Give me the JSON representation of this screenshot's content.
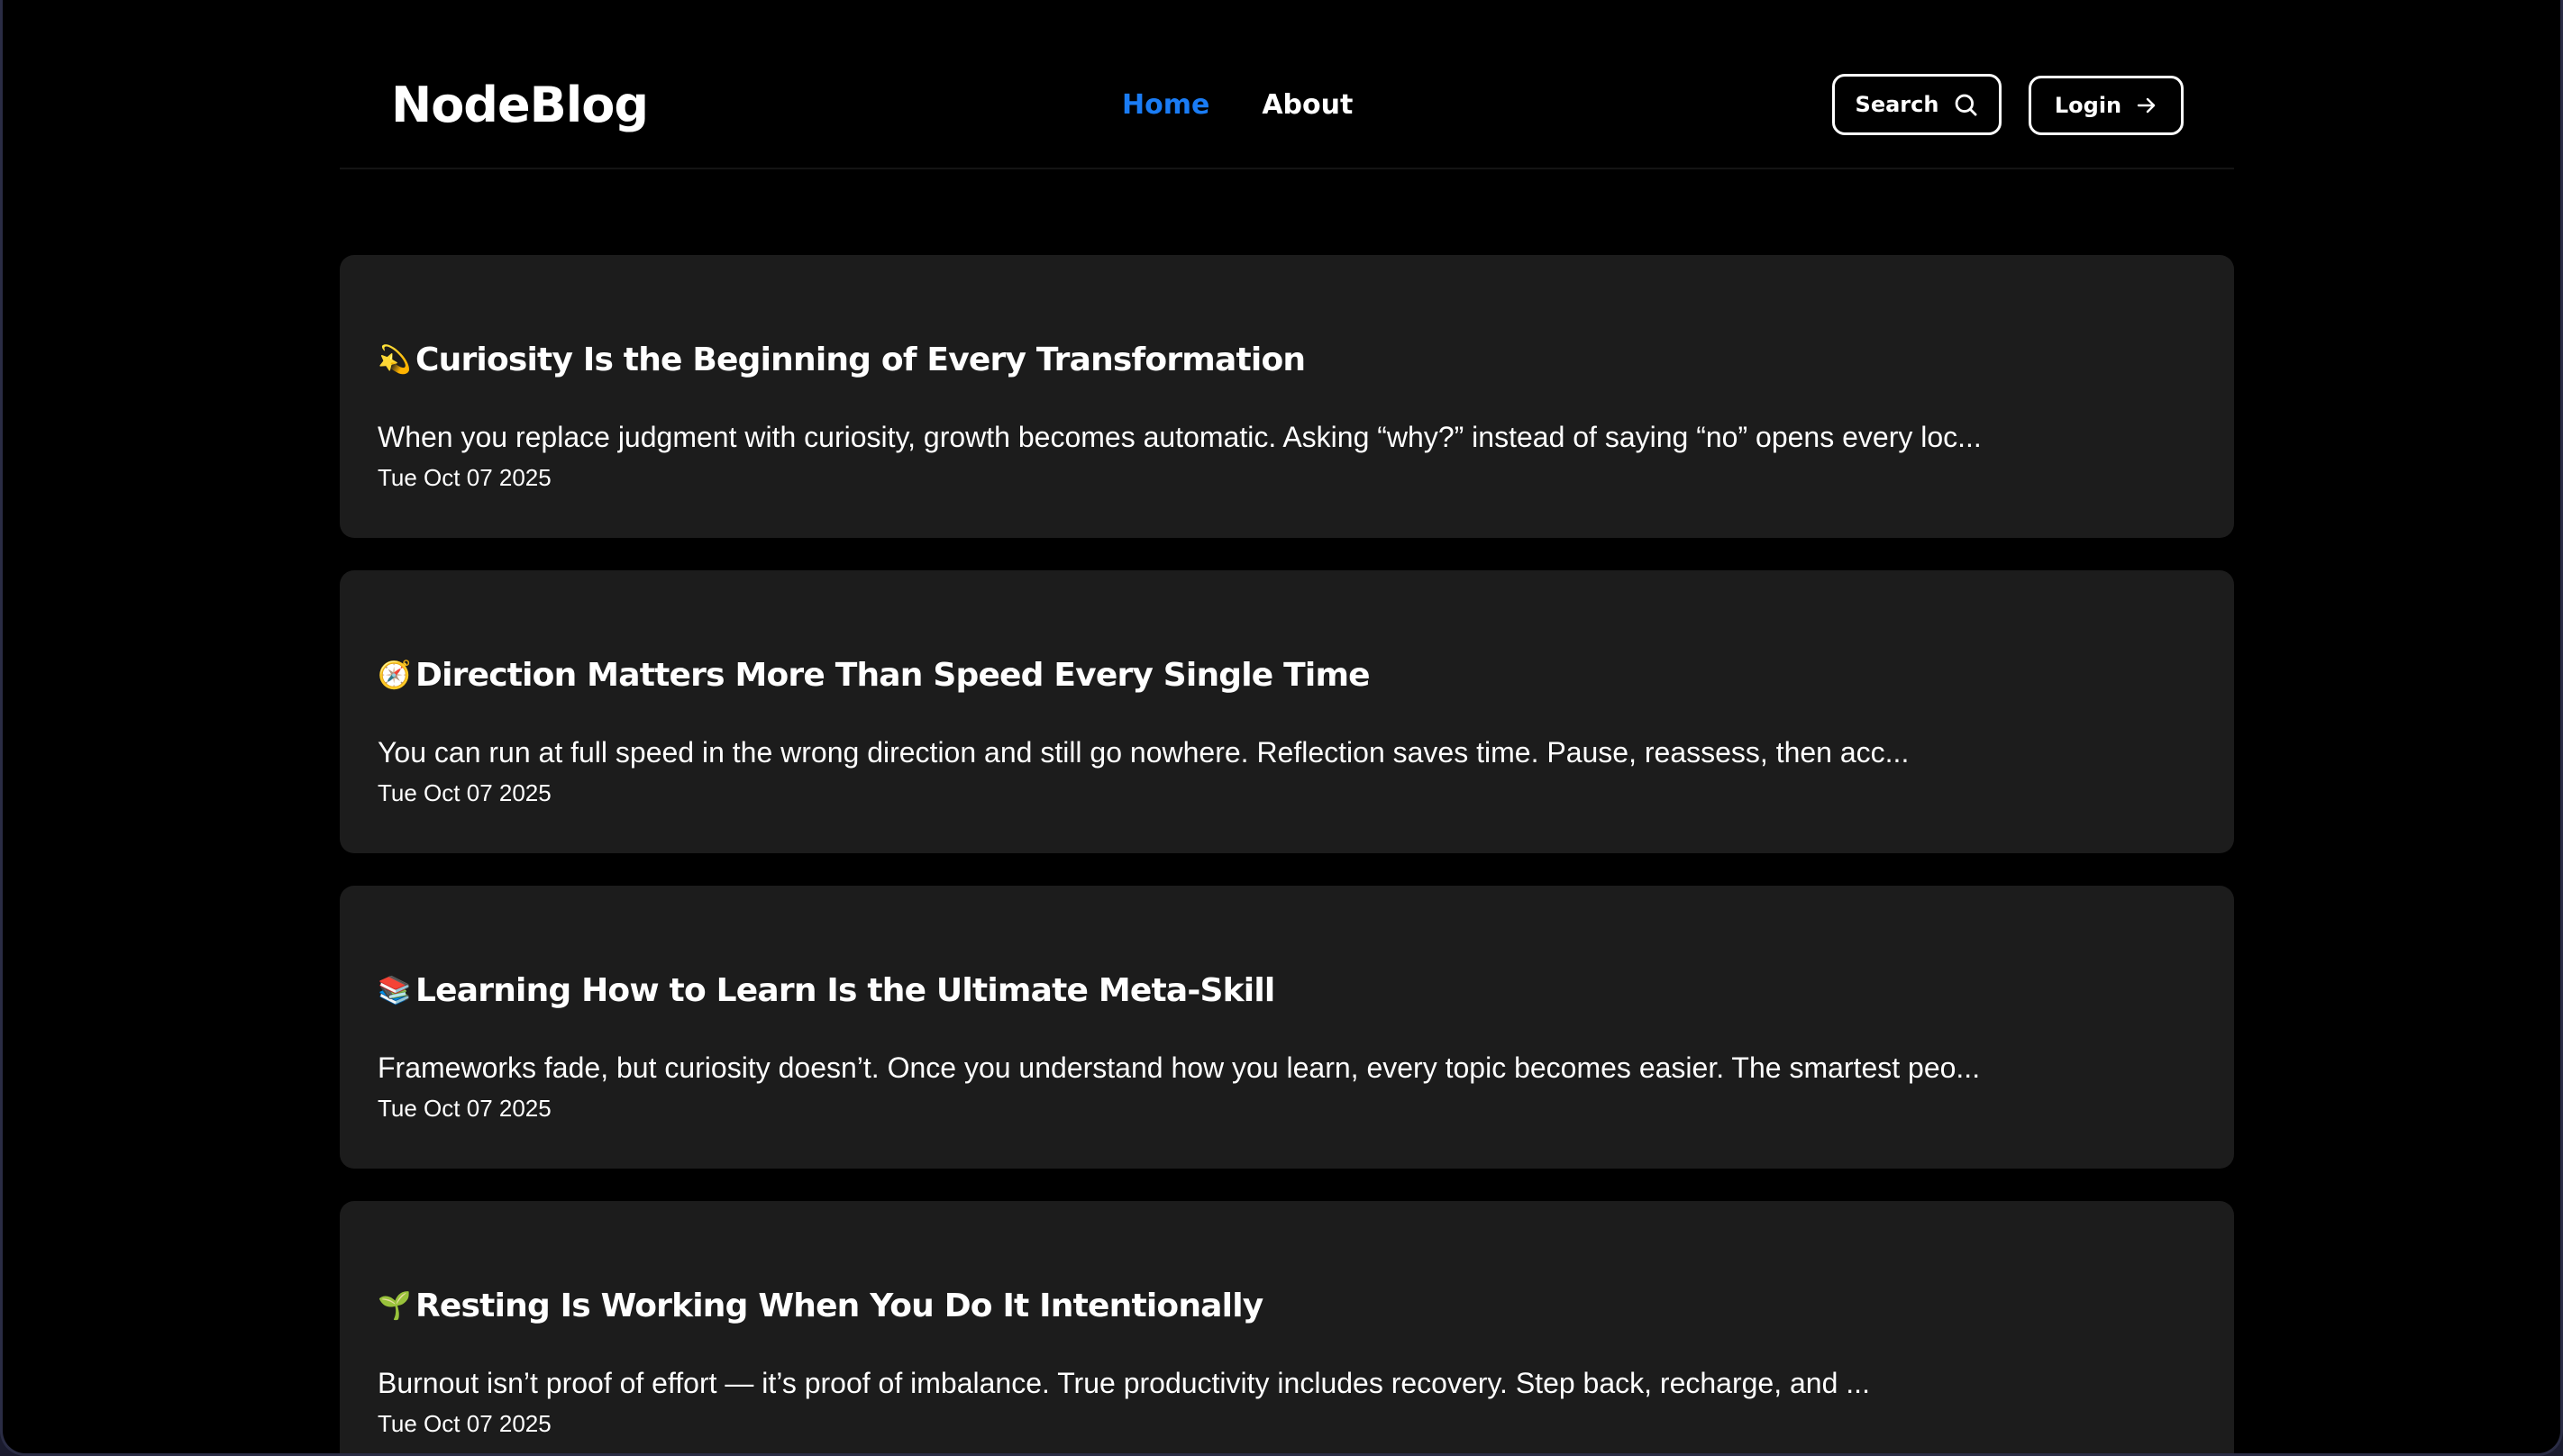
{
  "site": {
    "logo": "NodeBlog"
  },
  "nav": {
    "items": [
      {
        "label": "Home",
        "active": true
      },
      {
        "label": "About",
        "active": false
      }
    ]
  },
  "actions": {
    "search_label": "Search",
    "search_icon": "search-icon",
    "login_label": "Login",
    "login_icon": "arrow-right-icon"
  },
  "colors": {
    "background": "#000000",
    "card": "#1c1c1c",
    "accent": "#1a7cf5",
    "text": "#ffffff"
  },
  "posts": [
    {
      "emoji": "💫",
      "emoji_icon": "dizzy-star-icon",
      "title": "Curiosity Is the Beginning of Every Transformation",
      "excerpt": "When you replace judgment with curiosity, growth becomes automatic. Asking “why?” instead of saying “no” opens every loc...",
      "date": "Tue Oct 07 2025"
    },
    {
      "emoji": "🧭",
      "emoji_icon": "compass-icon",
      "title": "Direction Matters More Than Speed Every Single Time",
      "excerpt": "You can run at full speed in the wrong direction and still go nowhere. Reflection saves time. Pause, reassess, then acc...",
      "date": "Tue Oct 07 2025"
    },
    {
      "emoji": "📚",
      "emoji_icon": "books-icon",
      "title": "Learning How to Learn Is the Ultimate Meta-Skill",
      "excerpt": "Frameworks fade, but curiosity doesn’t. Once you understand how you learn, every topic becomes easier. The smartest peo...",
      "date": "Tue Oct 07 2025"
    },
    {
      "emoji": "🌱",
      "emoji_icon": "seedling-icon",
      "title": "Resting Is Working When You Do It Intentionally",
      "excerpt": "Burnout isn’t proof of effort — it’s proof of imbalance. True productivity includes recovery. Step back, recharge, and ...",
      "date": "Tue Oct 07 2025"
    }
  ]
}
